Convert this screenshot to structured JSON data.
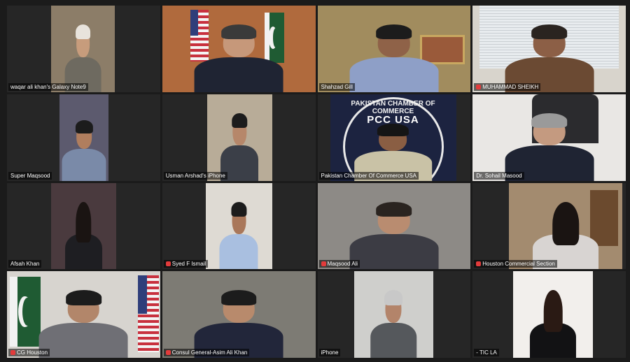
{
  "participants": [
    {
      "name": "waqar ali khan's Galaxy Note9",
      "muted": false,
      "active": false
    },
    {
      "name": "",
      "muted": false,
      "active": true
    },
    {
      "name": "Shahzad Gill",
      "muted": false,
      "active": false
    },
    {
      "name": "MUHAMMAD SHEIKH",
      "muted": true,
      "active": false
    },
    {
      "name": "Super Maqsood",
      "muted": false,
      "active": false
    },
    {
      "name": "Usman Arshad's iPhone",
      "muted": false,
      "active": false
    },
    {
      "name": "Pakistan Chamber Of Commerce USA",
      "muted": false,
      "active": false
    },
    {
      "name": "Dr. Sohail Masood",
      "muted": false,
      "active": false
    },
    {
      "name": "Afsah Khan",
      "muted": false,
      "active": false
    },
    {
      "name": "Syed F Ismail",
      "muted": true,
      "active": false
    },
    {
      "name": "Maqsood Ali",
      "muted": true,
      "active": false
    },
    {
      "name": "Houston Commercial Section",
      "muted": true,
      "active": false
    },
    {
      "name": "CG Houston",
      "muted": true,
      "active": false
    },
    {
      "name": "Consul General-Asim Ali Khan",
      "muted": true,
      "active": false
    },
    {
      "name": "iPhone",
      "muted": false,
      "active": false
    },
    {
      "name": "- TIC LA",
      "muted": false,
      "active": false
    }
  ],
  "backdrop_text": {
    "arc": "PAKISTAN CHAMBER OF COMMERCE",
    "logo": "PCC USA"
  },
  "colors": {
    "background": "#1b1b1b",
    "tile": "#262626",
    "active_speaker_border": "#d9d200",
    "muted_icon": "#e23b3b"
  }
}
